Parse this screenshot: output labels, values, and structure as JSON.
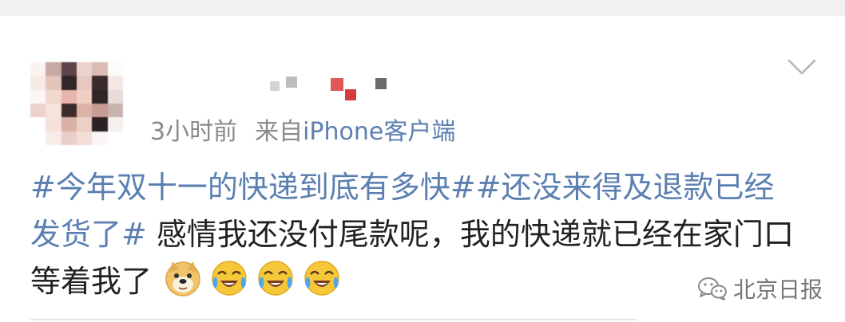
{
  "post": {
    "author_name": "",
    "time": "3小时前",
    "source_prefix": "来自",
    "source_client": "iPhone客户端",
    "hashtag_1": "#今年双十一的快递到底有多快#",
    "hashtag_2": "#还没来得及退款已经发货了#",
    "text": " 感情我还没付尾款呢，我的快递就已经在家门口等着我了",
    "emojis": [
      "doge-emoji",
      "laugh-cry-emoji",
      "laugh-cry-emoji",
      "laugh-cry-emoji"
    ]
  },
  "watermark": {
    "label": "北京日报",
    "icon": "wechat-icon"
  },
  "colors": {
    "link": "#5b7fb1",
    "text": "#222222",
    "meta": "#8a8a8a",
    "background": "#ffffff"
  }
}
